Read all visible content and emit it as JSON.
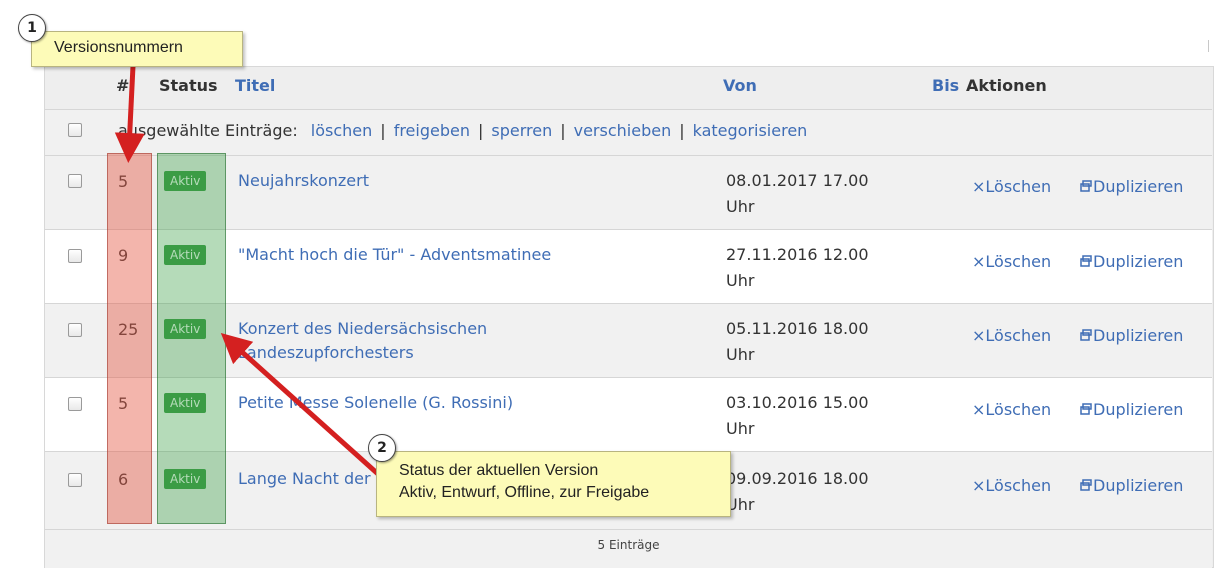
{
  "header": {
    "num": "#",
    "status": "Status",
    "title": "Titel",
    "from": "Von",
    "to": "Bis",
    "actions": "Aktionen"
  },
  "bulk": {
    "label": "ausgewählte Einträge:",
    "actions": [
      "löschen",
      "freigeben",
      "sperren",
      "verschieben",
      "kategorisieren"
    ]
  },
  "rows": [
    {
      "num": "5",
      "status": "Aktiv",
      "title": "Neujahrskonzert",
      "date": "08.01.2017 17.00",
      "unit": "Uhr",
      "delete": "×Löschen",
      "duplicate": "Duplizieren"
    },
    {
      "num": "9",
      "status": "Aktiv",
      "title": "\"Macht hoch die Tür\" - Adventsmatinee",
      "date": "27.11.2016 12.00",
      "unit": "Uhr",
      "delete": "×Löschen",
      "duplicate": "Duplizieren"
    },
    {
      "num": "25",
      "status": "Aktiv",
      "title": "Konzert des Niedersächsischen Landeszupforchesters",
      "date": "05.11.2016 18.00",
      "unit": "Uhr",
      "delete": "×Löschen",
      "duplicate": "Duplizieren"
    },
    {
      "num": "5",
      "status": "Aktiv",
      "title": "Petite Messe Solenelle (G. Rossini)",
      "date": "03.10.2016 15.00",
      "unit": "Uhr",
      "delete": "×Löschen",
      "duplicate": "Duplizieren"
    },
    {
      "num": "6",
      "status": "Aktiv",
      "title": "Lange Nacht der Chöre",
      "date": "09.09.2016 18.00",
      "unit": "Uhr",
      "delete": "×Löschen",
      "duplicate": "Duplizieren"
    }
  ],
  "footer": {
    "count": "5 Einträge"
  },
  "annotations": {
    "one": {
      "number": "1",
      "text": "Versionsnummern"
    },
    "two": {
      "number": "2",
      "line1": "Status der aktuellen Version",
      "line2": "Aktiv, Entwurf, Offline, zur Freigabe"
    }
  },
  "icons": {
    "duplicate": "duplicate-icon",
    "delete": "delete-x"
  },
  "colors": {
    "link": "#3f6db5",
    "badge": "#3a9a45",
    "callout": "#fdfbb8",
    "arrow": "#d42020"
  }
}
